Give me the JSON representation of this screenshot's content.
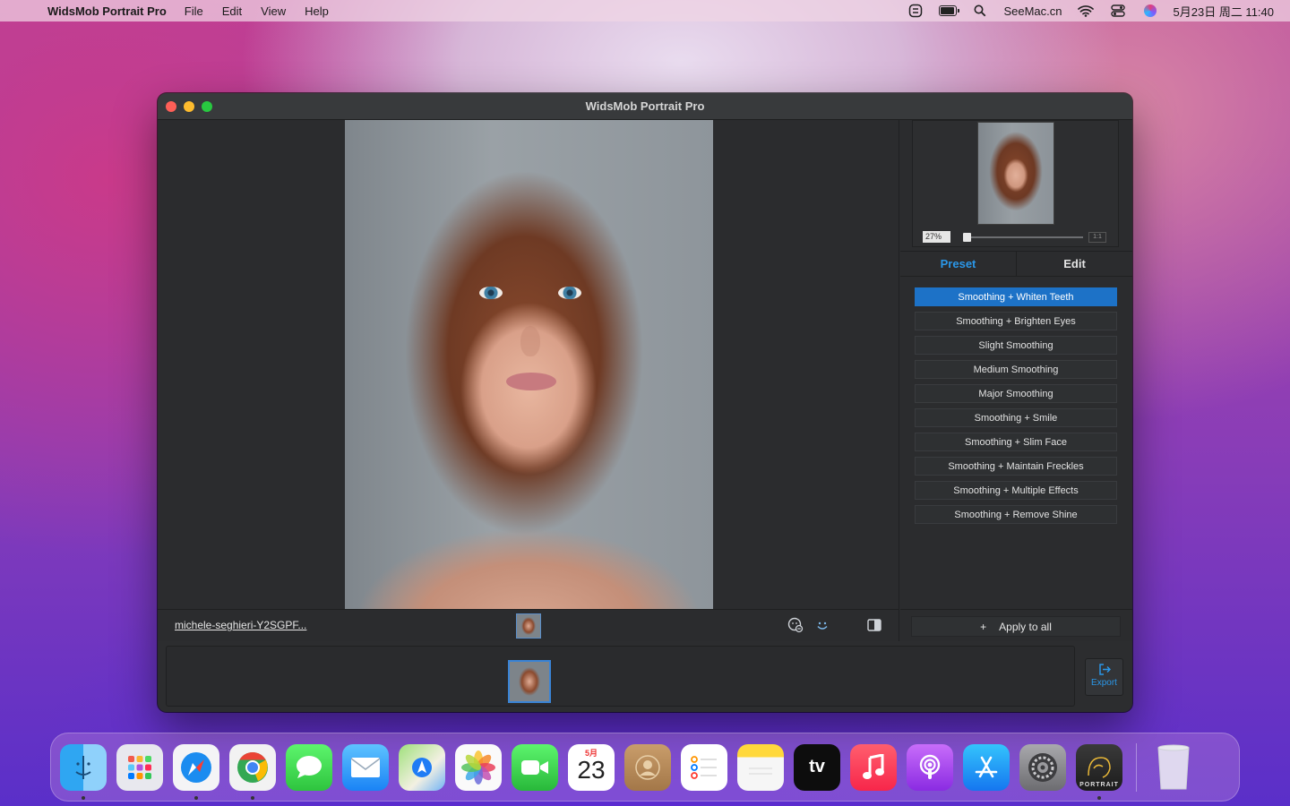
{
  "menubar": {
    "apple_glyph": "",
    "app_name": "WidsMob Portrait Pro",
    "menus": [
      "File",
      "Edit",
      "View",
      "Help"
    ],
    "site": "SeeMac.cn",
    "datetime": "5月23日 周二  11:40",
    "icons": [
      "menu-app-icon",
      "battery-icon",
      "search-icon",
      "wifi-icon",
      "control-center-icon",
      "siri-icon"
    ],
    "battery_level": 0.8
  },
  "window": {
    "title": "WidsMob Portrait Pro",
    "filename": "michele-seghieri-Y2SGPF...",
    "navigator": {
      "zoom": "27%",
      "one_to_one": "1:1"
    },
    "tabs": [
      "Preset",
      "Edit"
    ],
    "active_tab": "Preset",
    "presets": [
      "Smoothing + Whiten Teeth",
      "Smoothing + Brighten Eyes",
      "Slight Smoothing",
      "Medium Smoothing",
      "Major Smoothing",
      "Smoothing + Smile",
      "Smoothing + Slim Face",
      "Smoothing + Maintain Freckles",
      "Smoothing + Multiple Effects",
      "Smoothing + Remove Shine"
    ],
    "selected_preset": "Smoothing + Whiten Teeth",
    "apply_label": "Apply to all",
    "apply_icon": "+",
    "export_label": "Export",
    "accent_color": "#2b97e8",
    "selection_color": "#1d72c7"
  },
  "dock": {
    "apps": [
      "Finder",
      "Launchpad",
      "Safari",
      "Chrome",
      "Messages",
      "Mail",
      "Maps",
      "Photos",
      "FaceTime",
      "Calendar",
      "Contacts",
      "Reminders",
      "Notes",
      "Apple TV",
      "Music",
      "Podcasts",
      "App Store",
      "System Preferences",
      "WidsMob Portrait Pro",
      "Trash"
    ],
    "calendar_month": "5月",
    "calendar_day": "23",
    "portrait_label": "PORTRAIT",
    "tv_label": "tv"
  }
}
